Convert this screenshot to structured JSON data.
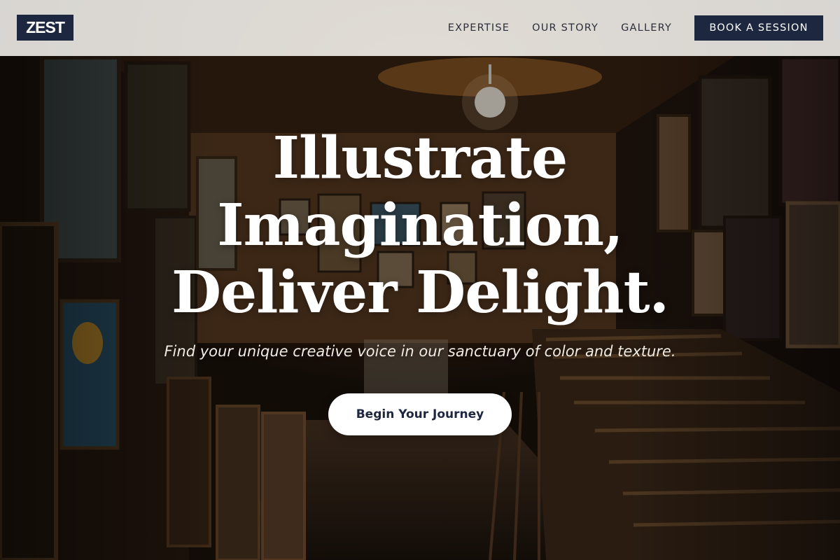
{
  "brand": {
    "logo_text": "ZEST",
    "primary_color": "#1e2740"
  },
  "nav": {
    "links": [
      {
        "label": "EXPERTISE"
      },
      {
        "label": "OUR STORY"
      },
      {
        "label": "GALLERY"
      }
    ],
    "cta_label": "BOOK A SESSION"
  },
  "hero": {
    "headline_lines": [
      "Illustrate",
      "Imagination,",
      "Deliver Delight."
    ],
    "subtitle": "Find your unique creative voice in our sanctuary of color and texture.",
    "button_label": "Begin Your Journey",
    "background_description_icon": "art-gallery-background"
  }
}
